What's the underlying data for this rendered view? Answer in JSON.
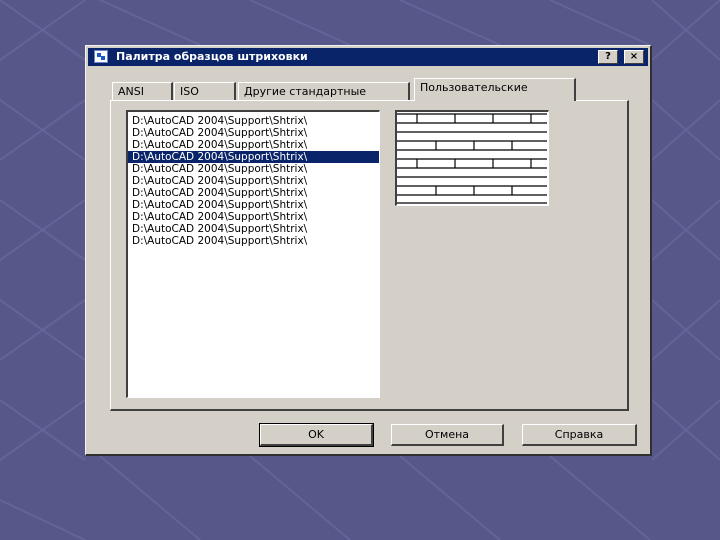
{
  "dialog": {
    "title": "Палитра образцов штриховки",
    "help_button": "?",
    "close_button": "×",
    "tabs": [
      {
        "label": "ANSI"
      },
      {
        "label": "ISO"
      },
      {
        "label": "Другие стандартные"
      },
      {
        "label": "Пользовательские"
      }
    ],
    "active_tab": "Пользовательские",
    "file_list": [
      "D:\\AutoCAD 2004\\Support\\Shtrix\\",
      "D:\\AutoCAD 2004\\Support\\Shtrix\\",
      "D:\\AutoCAD 2004\\Support\\Shtrix\\",
      "D:\\AutoCAD 2004\\Support\\Shtrix\\",
      "D:\\AutoCAD 2004\\Support\\Shtrix\\",
      "D:\\AutoCAD 2004\\Support\\Shtrix\\",
      "D:\\AutoCAD 2004\\Support\\Shtrix\\",
      "D:\\AutoCAD 2004\\Support\\Shtrix\\",
      "D:\\AutoCAD 2004\\Support\\Shtrix\\",
      "D:\\AutoCAD 2004\\Support\\Shtrix\\",
      "D:\\AutoCAD 2004\\Support\\Shtrix\\"
    ],
    "selected_index": 3,
    "buttons": {
      "ok": "OK",
      "cancel": "Отмена",
      "help": "Справка"
    }
  },
  "colors": {
    "background": "#57578a",
    "titlebar": "#0a246a",
    "dialog_face": "#d4d0c8",
    "selection": "#0a246a"
  },
  "icons": [
    "app-icon",
    "help-icon",
    "close-icon"
  ]
}
